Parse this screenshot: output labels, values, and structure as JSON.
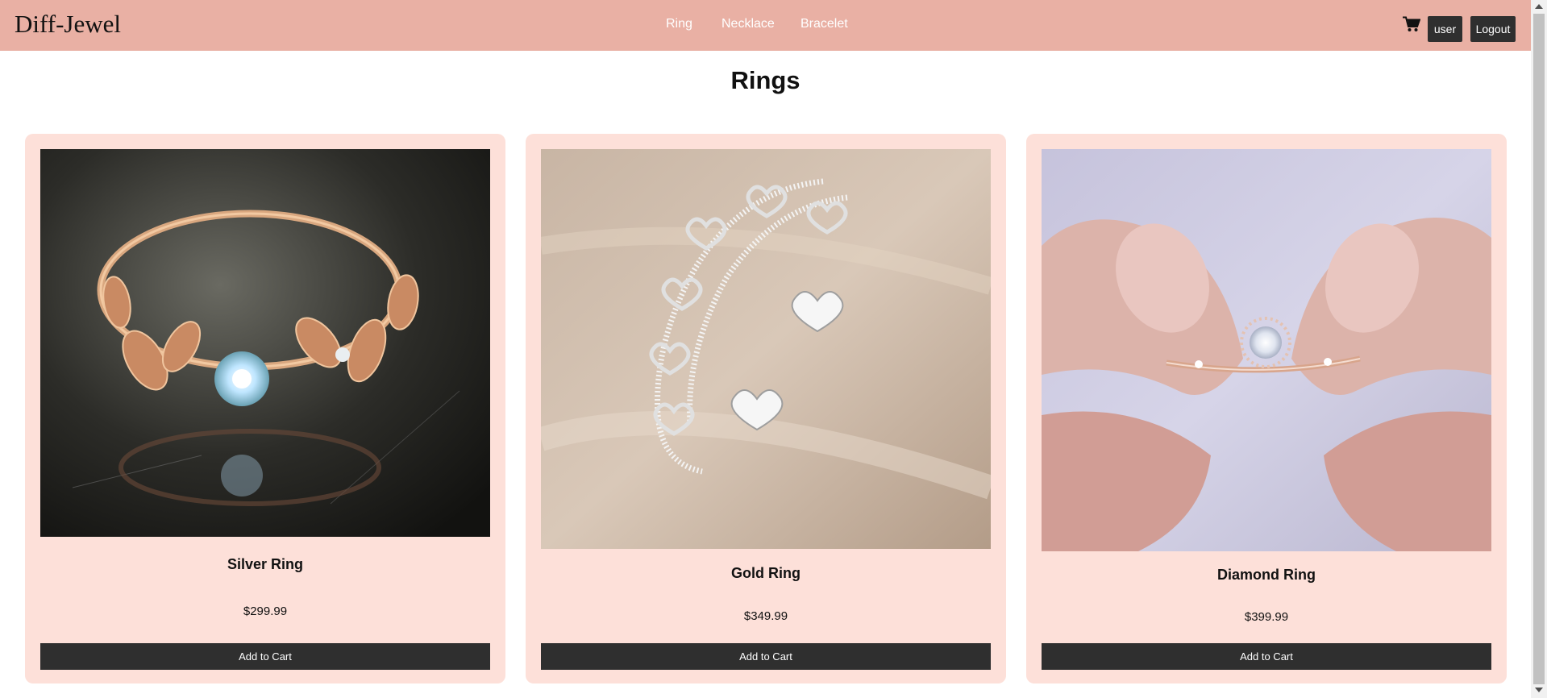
{
  "header": {
    "brand": "Diff-Jewel",
    "nav": [
      "Ring",
      "Necklace",
      "Bracelet"
    ],
    "cart_icon": "shopping-cart-icon",
    "user_label": "user",
    "logout_label": "Logout"
  },
  "page": {
    "title": "Rings"
  },
  "products": [
    {
      "name": "Silver Ring",
      "price": "$299.99",
      "button": "Add to Cart",
      "image": "rose-gold-leaf-ring-photo"
    },
    {
      "name": "Gold Ring",
      "price": "$349.99",
      "button": "Add to Cart",
      "image": "silver-heart-ring-photo"
    },
    {
      "name": "Diamond Ring",
      "price": "$399.99",
      "button": "Add to Cart",
      "image": "diamond-ring-fingers-photo"
    }
  ],
  "colors": {
    "navbar": "#e9b0a4",
    "card": "#fde0d9",
    "button": "#2f2f2f"
  }
}
